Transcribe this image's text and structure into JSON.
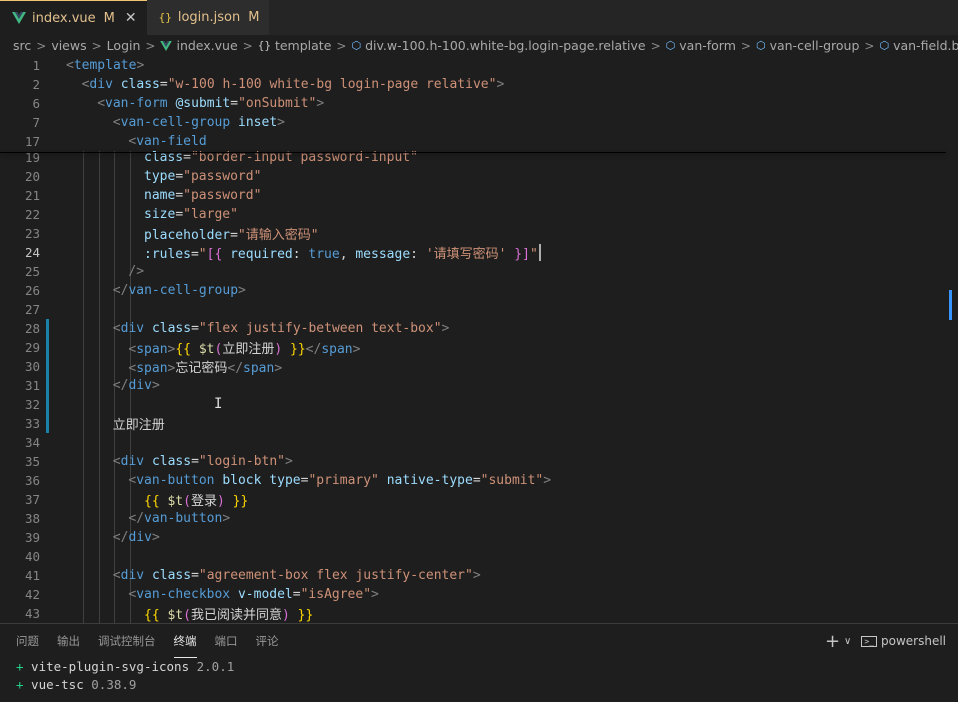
{
  "tabs": [
    {
      "name": "index.vue",
      "mod": "M",
      "icon": "vue-icon",
      "active": true
    },
    {
      "name": "login.json",
      "mod": "M",
      "icon": "json-icon",
      "active": false
    }
  ],
  "breadcrumb": [
    {
      "label": "src",
      "icon": ""
    },
    {
      "label": "views",
      "icon": ""
    },
    {
      "label": "Login",
      "icon": ""
    },
    {
      "label": "index.vue",
      "icon": "vue-icon"
    },
    {
      "label": "template",
      "icon": "braces-icon"
    },
    {
      "label": "div.w-100.h-100.white-bg.login-page.relative",
      "icon": "cube-icon"
    },
    {
      "label": "van-form",
      "icon": "cube-icon"
    },
    {
      "label": "van-cell-group",
      "icon": "cube-icon"
    },
    {
      "label": "van-field.border-input",
      "icon": "cube-icon"
    }
  ],
  "editor": {
    "current_line": "24",
    "lines": [
      {
        "n": "1",
        "indent": 0,
        "tokens": [
          [
            "punc",
            "<"
          ],
          [
            "tag",
            "template"
          ],
          [
            "punc",
            ">"
          ]
        ]
      },
      {
        "n": "2",
        "indent": 1,
        "tokens": [
          [
            "punc",
            "<"
          ],
          [
            "tag",
            "div"
          ],
          [
            "plain",
            " "
          ],
          [
            "attr",
            "class"
          ],
          [
            "plain",
            "="
          ],
          [
            "str",
            "\"w-100 h-100 white-bg login-page relative\""
          ],
          [
            "punc",
            ">"
          ]
        ]
      },
      {
        "n": "6",
        "indent": 2,
        "tokens": [
          [
            "punc",
            "<"
          ],
          [
            "tag",
            "van-form"
          ],
          [
            "plain",
            " "
          ],
          [
            "attr",
            "@submit"
          ],
          [
            "plain",
            "="
          ],
          [
            "str",
            "\"onSubmit\""
          ],
          [
            "punc",
            ">"
          ]
        ]
      },
      {
        "n": "7",
        "indent": 3,
        "tokens": [
          [
            "punc",
            "<"
          ],
          [
            "tag",
            "van-cell-group"
          ],
          [
            "plain",
            " "
          ],
          [
            "attr",
            "inset"
          ],
          [
            "punc",
            ">"
          ]
        ]
      },
      {
        "n": "17",
        "indent": 4,
        "tokens": [
          [
            "punc",
            "<"
          ],
          [
            "tag",
            "van-field"
          ]
        ]
      },
      {
        "n": "19",
        "indent": 5,
        "tokens": [
          [
            "attr",
            "class"
          ],
          [
            "plain",
            "="
          ],
          [
            "str",
            "\"border-input password-input\""
          ]
        ]
      },
      {
        "n": "20",
        "indent": 5,
        "tokens": [
          [
            "attr",
            "type"
          ],
          [
            "plain",
            "="
          ],
          [
            "str",
            "\"password\""
          ]
        ]
      },
      {
        "n": "21",
        "indent": 5,
        "tokens": [
          [
            "attr",
            "name"
          ],
          [
            "plain",
            "="
          ],
          [
            "str",
            "\"password\""
          ]
        ]
      },
      {
        "n": "22",
        "indent": 5,
        "tokens": [
          [
            "attr",
            "size"
          ],
          [
            "plain",
            "="
          ],
          [
            "str",
            "\"large\""
          ]
        ]
      },
      {
        "n": "23",
        "indent": 5,
        "tokens": [
          [
            "attr",
            "placeholder"
          ],
          [
            "plain",
            "="
          ],
          [
            "str",
            "\"请输入密码\""
          ]
        ]
      },
      {
        "n": "24",
        "indent": 5,
        "tokens": [
          [
            "attr",
            ":rules"
          ],
          [
            "plain",
            "="
          ],
          [
            "str",
            "\""
          ],
          [
            "brace",
            "[{"
          ],
          [
            "plain",
            " "
          ],
          [
            "attr",
            "required"
          ],
          [
            "plain",
            ": "
          ],
          [
            "kw",
            "true"
          ],
          [
            "plain",
            ", "
          ],
          [
            "attr",
            "message"
          ],
          [
            "plain",
            ": "
          ],
          [
            "str",
            "'请填写密码'"
          ],
          [
            "plain",
            " "
          ],
          [
            "brace",
            "}]"
          ],
          [
            "str",
            "\""
          ]
        ]
      },
      {
        "n": "25",
        "indent": 4,
        "tokens": [
          [
            "punc",
            "/>"
          ]
        ]
      },
      {
        "n": "26",
        "indent": 3,
        "tokens": [
          [
            "punc",
            "</"
          ],
          [
            "tag",
            "van-cell-group"
          ],
          [
            "punc",
            ">"
          ]
        ]
      },
      {
        "n": "27",
        "indent": 0,
        "tokens": []
      },
      {
        "n": "28",
        "indent": 3,
        "tokens": [
          [
            "punc",
            "<"
          ],
          [
            "tag",
            "div"
          ],
          [
            "plain",
            " "
          ],
          [
            "attr",
            "class"
          ],
          [
            "plain",
            "="
          ],
          [
            "str",
            "\"flex justify-between text-box\""
          ],
          [
            "punc",
            ">"
          ]
        ]
      },
      {
        "n": "29",
        "indent": 4,
        "tokens": [
          [
            "punc",
            "<"
          ],
          [
            "tag",
            "span"
          ],
          [
            "punc",
            ">"
          ],
          [
            "brace2",
            "{{"
          ],
          [
            "plain",
            " "
          ],
          [
            "yel",
            "$t"
          ],
          [
            "brace",
            "("
          ],
          [
            "plain",
            "立即注册"
          ],
          [
            "brace",
            ")"
          ],
          [
            "plain",
            " "
          ],
          [
            "brace2",
            "}}"
          ],
          [
            "punc",
            "</"
          ],
          [
            "tag",
            "span"
          ],
          [
            "punc",
            ">"
          ]
        ]
      },
      {
        "n": "30",
        "indent": 4,
        "tokens": [
          [
            "punc",
            "<"
          ],
          [
            "tag",
            "span"
          ],
          [
            "punc",
            ">"
          ],
          [
            "plain",
            "忘记密码"
          ],
          [
            "punc",
            "</"
          ],
          [
            "tag",
            "span"
          ],
          [
            "punc",
            ">"
          ]
        ]
      },
      {
        "n": "31",
        "indent": 3,
        "tokens": [
          [
            "punc",
            "</"
          ],
          [
            "tag",
            "div"
          ],
          [
            "punc",
            ">"
          ]
        ]
      },
      {
        "n": "32",
        "indent": 0,
        "tokens": []
      },
      {
        "n": "33",
        "indent": 3,
        "tokens": [
          [
            "plain",
            "立即注册"
          ]
        ]
      },
      {
        "n": "34",
        "indent": 0,
        "tokens": []
      },
      {
        "n": "35",
        "indent": 3,
        "tokens": [
          [
            "punc",
            "<"
          ],
          [
            "tag",
            "div"
          ],
          [
            "plain",
            " "
          ],
          [
            "attr",
            "class"
          ],
          [
            "plain",
            "="
          ],
          [
            "str",
            "\"login-btn\""
          ],
          [
            "punc",
            ">"
          ]
        ]
      },
      {
        "n": "36",
        "indent": 4,
        "tokens": [
          [
            "punc",
            "<"
          ],
          [
            "tag",
            "van-button"
          ],
          [
            "plain",
            " "
          ],
          [
            "attr",
            "block"
          ],
          [
            "plain",
            " "
          ],
          [
            "attr",
            "type"
          ],
          [
            "plain",
            "="
          ],
          [
            "str",
            "\"primary\""
          ],
          [
            "plain",
            " "
          ],
          [
            "attr",
            "native-type"
          ],
          [
            "plain",
            "="
          ],
          [
            "str",
            "\"submit\""
          ],
          [
            "punc",
            ">"
          ]
        ]
      },
      {
        "n": "37",
        "indent": 5,
        "tokens": [
          [
            "brace2",
            "{{"
          ],
          [
            "plain",
            " "
          ],
          [
            "yel",
            "$t"
          ],
          [
            "brace",
            "("
          ],
          [
            "plain",
            "登录"
          ],
          [
            "brace",
            ")"
          ],
          [
            "plain",
            " "
          ],
          [
            "brace2",
            "}}"
          ]
        ]
      },
      {
        "n": "38",
        "indent": 4,
        "tokens": [
          [
            "punc",
            "</"
          ],
          [
            "tag",
            "van-button"
          ],
          [
            "punc",
            ">"
          ]
        ]
      },
      {
        "n": "39",
        "indent": 3,
        "tokens": [
          [
            "punc",
            "</"
          ],
          [
            "tag",
            "div"
          ],
          [
            "punc",
            ">"
          ]
        ]
      },
      {
        "n": "40",
        "indent": 0,
        "tokens": []
      },
      {
        "n": "41",
        "indent": 3,
        "tokens": [
          [
            "punc",
            "<"
          ],
          [
            "tag",
            "div"
          ],
          [
            "plain",
            " "
          ],
          [
            "attr",
            "class"
          ],
          [
            "plain",
            "="
          ],
          [
            "str",
            "\"agreement-box flex justify-center\""
          ],
          [
            "punc",
            ">"
          ]
        ]
      },
      {
        "n": "42",
        "indent": 4,
        "tokens": [
          [
            "punc",
            "<"
          ],
          [
            "tag",
            "van-checkbox"
          ],
          [
            "plain",
            " "
          ],
          [
            "attr",
            "v-model"
          ],
          [
            "plain",
            "="
          ],
          [
            "str",
            "\"isAgree\""
          ],
          [
            "punc",
            ">"
          ]
        ]
      },
      {
        "n": "43",
        "indent": 5,
        "tokens": [
          [
            "brace2",
            "{{"
          ],
          [
            "plain",
            " "
          ],
          [
            "yel",
            "$t"
          ],
          [
            "brace",
            "("
          ],
          [
            "plain",
            "我已阅读并同意"
          ],
          [
            "brace",
            ")"
          ],
          [
            "plain",
            " "
          ],
          [
            "brace2",
            "}}"
          ]
        ]
      }
    ]
  },
  "panel": {
    "tabs": [
      "问题",
      "输出",
      "调试控制台",
      "终端",
      "端口",
      "评论"
    ],
    "active_tab": "终端",
    "terminal_label": "powershell",
    "terminal_lines": [
      {
        "prefix": "+",
        "pkg": "vite-plugin-svg-icons",
        "ver": "2.0.1"
      },
      {
        "prefix": "+",
        "pkg": "vue-tsc",
        "ver": "0.38.9"
      }
    ]
  },
  "colors": {
    "accent": "#007acc",
    "vue": "#41b883",
    "modified": "#e2c08d"
  }
}
